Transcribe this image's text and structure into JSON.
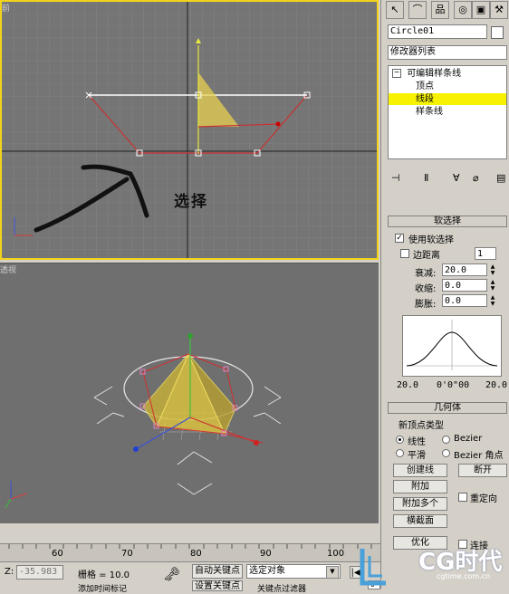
{
  "viewports": {
    "front": {
      "label": "前",
      "annotation": "选择"
    },
    "perspective": {
      "label": "透视"
    }
  },
  "panel": {
    "tab_icons": [
      "create-icon",
      "modify-icon",
      "hierarchy-icon",
      "motion-icon",
      "display-icon",
      "utilities-icon"
    ],
    "object_name": "Circle01",
    "modifier_list": "修改器列表",
    "stack": {
      "root": "可编辑样条线",
      "items": [
        "顶点",
        "线段",
        "样条线"
      ],
      "selected_index": 1
    },
    "soft_selection": {
      "title": "软选择",
      "use_soft_selection": "使用软选择",
      "use_soft_selection_checked": true,
      "edge_distance": "边距离",
      "edge_distance_value": "1",
      "falloff_label": "衰减:",
      "falloff_value": "20.0",
      "pinch_label": "收缩:",
      "pinch_value": "0.0",
      "bubble_label": "膨胀:",
      "bubble_value": "0.0",
      "curve_left": "20.0",
      "curve_mid": "0'0\"00",
      "curve_right": "20.0"
    },
    "geometry": {
      "title": "几何体",
      "new_vertex_type": "新顶点类型",
      "linear": "线性",
      "bezier": "Bezier",
      "smooth": "平滑",
      "bezier_corner": "Bezier 角点",
      "create_line": "创建线",
      "break": "断开",
      "attach": "附加",
      "reorient": "重定向",
      "attach_multiple": "附加多个",
      "cross_section": "横截面",
      "optimize": "优化",
      "connect": "连接"
    }
  },
  "timeline": {
    "ticks": [
      "60",
      "70",
      "80",
      "90",
      "100"
    ]
  },
  "statusbar": {
    "z_label": "Z:",
    "z_value": "-35.983",
    "grid": "栅格 = 10.0",
    "auto_key": "自动关键点",
    "selected_object": "选定对象",
    "set_key": "设置关键点",
    "key_filters": "关键点过滤器",
    "add_time_tag": "添加时间标记",
    "frame_value": "0"
  },
  "watermark": {
    "logo": "CG时代",
    "url": "cgtime.com.cn"
  }
}
